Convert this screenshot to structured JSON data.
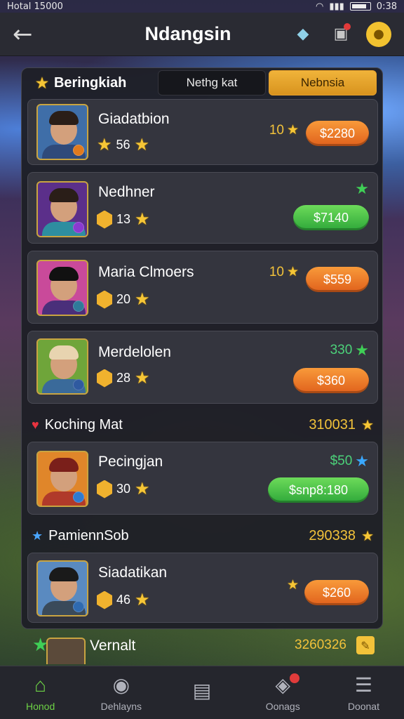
{
  "status_bar": {
    "left_text": "Hotal 15000",
    "right_text": "0:38"
  },
  "header": {
    "title": "Ndangsin",
    "back_icon": "arrow-left-icon",
    "icons": [
      "gift-icon",
      "bag-icon",
      "chat-icon"
    ]
  },
  "panel": {
    "title": "Beringkiah",
    "tabs": [
      {
        "label": "Nethg kat",
        "active": false
      },
      {
        "label": "Nebnsia",
        "active": true
      }
    ]
  },
  "cards": [
    {
      "name": "Giadatbion",
      "rating": "56",
      "score": "10",
      "score_color": "gold",
      "price": "$2280",
      "price_color": "orange"
    },
    {
      "name": "Nedhner",
      "rating": "13",
      "score": "",
      "score_color": "green",
      "price": "$7140",
      "price_color": "green"
    },
    {
      "name": "Maria Clmoers",
      "rating": "20",
      "score": "10",
      "score_color": "gold",
      "price": "$559",
      "price_color": "orange"
    },
    {
      "name": "Merdelolen",
      "rating": "28",
      "score": "330",
      "score_color": "green",
      "price": "$360",
      "price_color": "orange"
    }
  ],
  "section1": {
    "label": "Koching Mat",
    "score": "310031"
  },
  "card5": {
    "name": "Pecingjan",
    "rating": "30",
    "score": "$50",
    "price": "$snp8:180"
  },
  "section2": {
    "label": "PamiennSob",
    "score": "290338"
  },
  "card6": {
    "name": "Siadatikan",
    "rating": "46",
    "price": "$260"
  },
  "overflow": {
    "name": "Vernalt",
    "score": "3260326"
  },
  "nav": [
    {
      "label": "Honod",
      "icon": "home-icon",
      "active": true
    },
    {
      "label": "Dehlayns",
      "icon": "users-icon",
      "active": false
    },
    {
      "label": "",
      "icon": "clipboard-icon",
      "active": false
    },
    {
      "label": "Oonags",
      "icon": "gamepad-icon",
      "active": false
    },
    {
      "label": "Doonat",
      "icon": "menu-icon",
      "active": false
    }
  ],
  "colors": {
    "accent_orange": "#e0611c",
    "accent_green": "#2fa83a",
    "gold": "#f2c23a",
    "panel": "#1e1f26"
  }
}
